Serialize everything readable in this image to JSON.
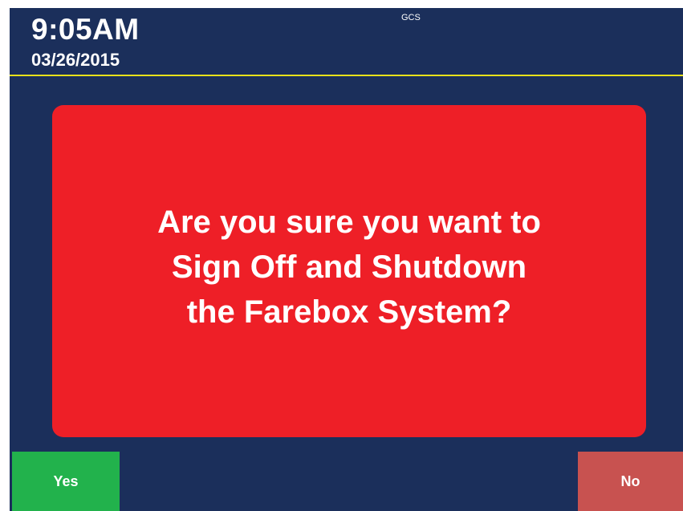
{
  "header": {
    "time": "9:05AM",
    "date": "03/26/2015",
    "app_label": "GCS"
  },
  "dialog": {
    "message_lines": [
      "Are you sure you want to",
      "Sign Off and Shutdown",
      "the Farebox System?"
    ]
  },
  "buttons": {
    "yes_label": "Yes",
    "no_label": "No"
  },
  "colors": {
    "background": "#1b2f5b",
    "divider": "#e8e21a",
    "dialog": "#ee1f27",
    "yes_button": "#22b24c",
    "no_button": "#c85250"
  }
}
